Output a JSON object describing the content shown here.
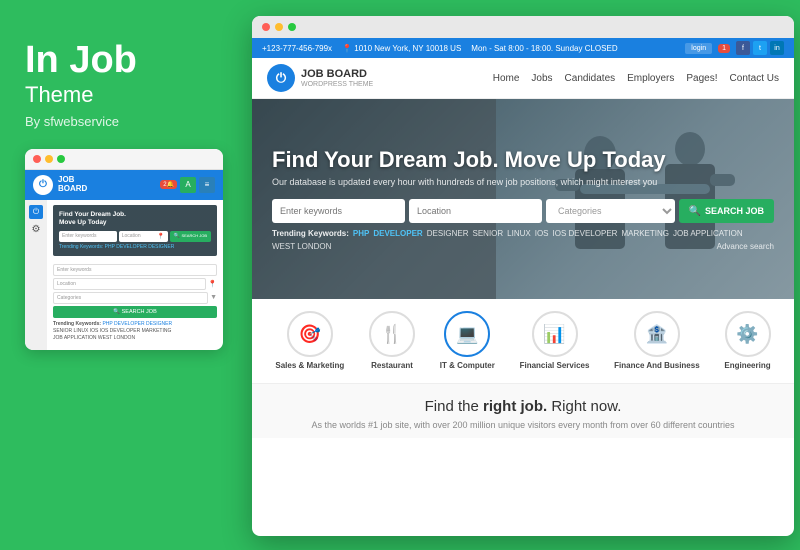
{
  "brand": {
    "title": "In Job",
    "subtitle": "Theme",
    "author": "By sfwebservice"
  },
  "browser": {
    "dots": [
      "red",
      "yellow",
      "green"
    ]
  },
  "topbar": {
    "phone": "+123-777-456-799x",
    "address": "1010 New York, NY 10018 US",
    "hours": "Mon - Sat 8:00 - 18:00. Sunday CLOSED",
    "login": "login",
    "badge": "1",
    "social": [
      "f",
      "t",
      "in"
    ]
  },
  "header": {
    "logo_text": "JOB BOARD",
    "logo_tagline": "WORDPRESS THEME",
    "nav": [
      "Home",
      "Jobs",
      "Candidates",
      "Employers",
      "Pages!",
      "Contact Us"
    ]
  },
  "hero": {
    "title": "Find Your Dream Job. Move Up Today",
    "subtitle": "Our database is updated every hour with hundreds of new job positions, which might interest you",
    "search": {
      "keywords_placeholder": "Enter keywords",
      "location_placeholder": "Location",
      "categories_placeholder": "Categories",
      "button": "SEARCH JOB"
    },
    "trending_label": "Trending Keywords:",
    "trending_tags": [
      "PHP",
      "DEVELOPER",
      "DESIGNER",
      "SENIOR",
      "LINUX",
      "IOS",
      "IOS DEVELOPER",
      "MARKETING",
      "JOB APPLICATION",
      "WEST LONDON"
    ],
    "advance_search": "Advance search"
  },
  "categories": [
    {
      "label": "Sales & Marketing",
      "icon": "🎯"
    },
    {
      "label": "Restaurant",
      "icon": "🍴"
    },
    {
      "label": "IT & Computer",
      "icon": "💻"
    },
    {
      "label": "Financial Services",
      "icon": "📊"
    },
    {
      "label": "Finance And Business",
      "icon": "🏦"
    },
    {
      "label": "Engineering",
      "icon": "⚙️"
    }
  ],
  "bottom": {
    "title_plain": "Find the ",
    "title_bold": "right job.",
    "title_end": " Right now.",
    "subtitle": "As the worlds #1 job site, with over 200 million unique visitors every month from over 60 different countries"
  },
  "mini_card": {
    "keywords_placeholder": "Enter keywords",
    "location_placeholder": "Location",
    "categories_placeholder": "Categories",
    "search_btn": "SEARCH JOB",
    "trending_label": "Trending Keywords:",
    "trending_tags": "PHP  DEVELOPER  DESIGNER  SENIOR  LINUX  IOS  IOS DEVELOPER  MARKETING  JOB APPLICATION  WEST LONDON"
  }
}
